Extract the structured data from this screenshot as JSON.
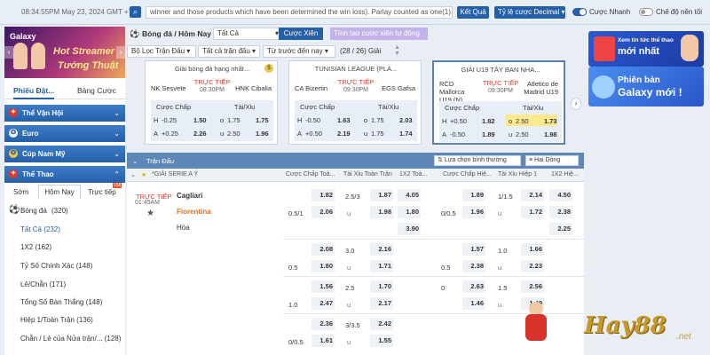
{
  "topbar": {
    "time": "08:34:55PM May 23, 2024 GMT +7",
    "marquee": "winner and those products which have been determined the win loss). Parlay counted as one(1).",
    "result_btn": "Kết Quả",
    "odds_type": "Tỷ lệ cược Decimal",
    "fast_bet": "Cược Nhanh",
    "night_mode": "Chế độ nền tối"
  },
  "sidebar": {
    "galaxy": "Galaxy",
    "banner_l1": "Hot Streamer",
    "banner_l2": "Tướng Thuật",
    "tabs": [
      "Phiếu Đặt...",
      "Bảng Cược"
    ],
    "cats": [
      "Thể Vận Hội",
      "Euro",
      "Cúp Nam Mỹ",
      "Thể Thao"
    ],
    "subtabs": [
      "Sớm",
      "Hôm Nay",
      "Trực tiếp"
    ],
    "live_badge": "158",
    "sport": "Bóng đá",
    "sport_count": "(320)",
    "items": [
      "Tất Cả (232)",
      "1X2 (162)",
      "Tỷ Số Chính Xác (148)",
      "Lẻ/Chẵn (171)",
      "Tổng Số Bàn Thắng (148)",
      "Hiệp 1/Toàn Trận (136)",
      "Chẵn / Lẻ của Nửa trận/... (128)"
    ]
  },
  "main": {
    "title": "Bóng đá / Hôm Nay",
    "select_all": "Tất Cả",
    "btn_combo": "Cược Xiên",
    "btn_create": "Tính tạo cược xiên tự động",
    "filters": [
      "Bộ Lọc Trận Đấu",
      "Tất cả trận đấu",
      "Từ trước đến nay"
    ],
    "count": "(28 / 26) Giải"
  },
  "cards": [
    {
      "league": "Giải bóng đá hạng nhất...",
      "home": "NK Sesvete",
      "away": "HNK Cibalia",
      "live": "TRỰC TIẾP",
      "time": "08:30PM",
      "hcap": "Cược Chấp",
      "ou": "Tài/Xỉu",
      "rows": [
        [
          "H",
          "-0.25",
          "1.50",
          "o",
          "1.75",
          "1.75"
        ],
        [
          "A",
          "+0.25",
          "2.26",
          "u",
          "2.50",
          "1.96"
        ]
      ]
    },
    {
      "league": "TUNISIAN LEAGUE (PLA...",
      "home": "CA Bizertin",
      "away": "EGS Gafsa",
      "live": "TRỰC TIẾP",
      "time": "09:30PM",
      "hcap": "Cược Chấp",
      "ou": "Tài/Xỉu",
      "rows": [
        [
          "H",
          "-0.50",
          "1.63",
          "o",
          "1.75",
          "2.03"
        ],
        [
          "A",
          "+0.50",
          "2.19",
          "u",
          "1.75",
          "1.74"
        ]
      ]
    },
    {
      "league": "GIẢI U19 TÂY BAN NHA...",
      "home": "RCD Mallorca U19 (N)",
      "away": "Atletico de Madrid U19",
      "live": "TRỰC TIẾP",
      "time": "09:30PM",
      "hcap": "Cược Chấp",
      "ou": "Tài/Xỉu",
      "rows": [
        [
          "H",
          "+0.50",
          "1.82",
          "o",
          "2.50",
          "1.73"
        ],
        [
          "A",
          "-0.50",
          "1.89",
          "u",
          "2.50",
          "1.98"
        ]
      ]
    }
  ],
  "ads": [
    "Xem tin tức thể thao",
    "mới nhất",
    "Phiên bản",
    "Galaxy mới !"
  ],
  "table": {
    "head": "Trận Đấu",
    "sort": "Lựa chọn bình thường",
    "lines": "Hai Dòng",
    "cols": [
      "Cược Chấp Toà...",
      "Tài Xỉu Toàn Trận",
      "1X2 Toà...",
      "Cược Chấp Hiệ...",
      "Tài Xỉu Hiệp 1",
      "1X2 Hiệ..."
    ],
    "league": "*GIẢI SERIE A Ý",
    "match": {
      "live": "TRỰC TIẾP",
      "time": "01:45AM",
      "home": "Cagliari",
      "away": "Fiorentina",
      "draw": "Hòa"
    },
    "rows": [
      {
        "hc": [
          "",
          "1.82",
          "0.5/1",
          "2.06"
        ],
        "ou": [
          "2.5/3",
          "1.87",
          "u",
          "1.98"
        ],
        "x12": [
          "4.05",
          "1.80",
          "3.90"
        ],
        "hc1": [
          "",
          "1.89",
          "0/0.5",
          "1.96"
        ],
        "ou1": [
          "1/1.5",
          "2.14",
          "u",
          "1.72"
        ],
        "x121": [
          "4.50",
          "2.38",
          "2.25"
        ]
      },
      {
        "hc": [
          "",
          "2.08",
          "0.5",
          "1.80"
        ],
        "ou": [
          "3.0",
          "2.16",
          "u",
          "1.71"
        ],
        "hc1": [
          "",
          "1.57",
          "0.5",
          "2.38"
        ],
        "ou1": [
          "1.0",
          "1.66",
          "u",
          "2.23"
        ]
      },
      {
        "hc": [
          "",
          "1.56",
          "1.0",
          "2.47"
        ],
        "ou": [
          "2.5",
          "1.70",
          "u",
          "2.17"
        ],
        "hc1": [
          "0",
          "2.63",
          "",
          "1.46"
        ],
        "ou1": [
          "1.5",
          "2.56",
          "u",
          "1.49"
        ]
      },
      {
        "hc": [
          "",
          "2.36",
          "0/0.5",
          "1.61"
        ],
        "ou": [
          "3/3.5",
          "2.42",
          "u",
          "1.55"
        ]
      }
    ]
  },
  "brand": {
    "name": "Hay88",
    "tld": ".net"
  }
}
